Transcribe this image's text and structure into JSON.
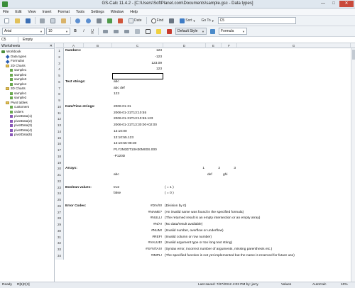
{
  "window": {
    "title": "GS-Calc 11.4.2 - [C:\\Users\\SoftPlanet.com\\Documents\\sample.gsc - Data types]",
    "controls": [
      "—",
      "□",
      "✕"
    ]
  },
  "menu": [
    "File",
    "Edit",
    "View",
    "Insert",
    "Format",
    "Tools",
    "Settings",
    "Window",
    "Help"
  ],
  "toolbar1": {
    "date_label": "Date",
    "find_label": "Find",
    "sort_label": "Sort",
    "goto_label": "Go To",
    "goto_value": "C5"
  },
  "toolbar2": {
    "font": "Arial",
    "size": "10",
    "style": "Default Style",
    "formula": "Formula"
  },
  "formula_bar": {
    "cell_ref": "C5",
    "value": "Empty"
  },
  "sidebar": {
    "title": "Worksheets",
    "items": [
      {
        "label": "Workbook",
        "icon": "book-icon",
        "indent": 0
      },
      {
        "label": "Data types",
        "icon": "diamond-icon",
        "indent": 1
      },
      {
        "label": "Formulas",
        "icon": "diamond-icon",
        "indent": 1
      },
      {
        "label": "2D Charts",
        "icon": "folder-icon",
        "indent": 1
      },
      {
        "label": "sample1",
        "icon": "sheet-icon",
        "indent": 2
      },
      {
        "label": "sample2",
        "icon": "sheet-icon",
        "indent": 2
      },
      {
        "label": "sample3",
        "icon": "sheet-icon",
        "indent": 2
      },
      {
        "label": "sample4",
        "icon": "sheet-icon",
        "indent": 2
      },
      {
        "label": "3D Charts",
        "icon": "folder-icon",
        "indent": 1
      },
      {
        "label": "sample1",
        "icon": "sheet-icon",
        "indent": 2
      },
      {
        "label": "sample2",
        "icon": "sheet-icon",
        "indent": 2
      },
      {
        "label": "Pivot tables",
        "icon": "folder-icon",
        "indent": 1
      },
      {
        "label": "customers",
        "icon": "sheet-icon",
        "indent": 2
      },
      {
        "label": "orders",
        "icon": "sheet-icon",
        "indent": 2
      },
      {
        "label": "pivotData(1)",
        "icon": "pivot-icon",
        "indent": 2
      },
      {
        "label": "pivotData(2)",
        "icon": "pivot-icon",
        "indent": 2
      },
      {
        "label": "pivotData(3)",
        "icon": "pivot-icon",
        "indent": 2
      },
      {
        "label": "pivotData(4)",
        "icon": "pivot-icon",
        "indent": 2
      },
      {
        "label": "pivotData(5)",
        "icon": "pivot-icon",
        "indent": 2
      }
    ]
  },
  "grid": {
    "columns": [
      "A",
      "B",
      "C",
      "D",
      "E",
      "F",
      "G"
    ],
    "rows": [
      "1",
      "2",
      "3",
      "4",
      "5",
      "6",
      "7",
      "8",
      "9",
      "10",
      "11",
      "12",
      "13",
      "14",
      "15",
      "16",
      "17",
      "18",
      "19",
      "20",
      "21",
      "22",
      "23",
      "24",
      "25",
      "26",
      "27",
      "28",
      "29",
      "30",
      "31",
      "32",
      "33",
      "34"
    ],
    "cells": {
      "A1": "Numbers:",
      "C1": "123",
      "C2": "-123",
      "C3": "123.09",
      "C4": "123",
      "A6": "Text strings:",
      "C6": "abc",
      "C7": "abc def",
      "C8": "123",
      "A10": "Date/Time strings:",
      "C10": "2006-01-31",
      "C11": "2006-01-31T13:10:55",
      "C12": "2006-01-31T13:10:55.123",
      "C13": "2006-01-31T13:30:00+02:00",
      "C14": "13:10:00",
      "C15": "13:10:55.123",
      "C16": "13:10:55-08:30",
      "C17": "P1Y2M3DT10H30M00S.000",
      "C18": "-P120D",
      "A20": "Arrays:",
      "D20": "1",
      "E20": "2",
      "F20": "3",
      "C21": "abc",
      "E21": "def",
      "F21": "ghi",
      "A23": "Boolean values:",
      "C23": "true",
      "D23": "( = 1 )",
      "C24": "false",
      "D24": "( = 0 )",
      "A26": "Error Codes:",
      "C26": "#DIV/0!",
      "D26": "(Division by 0)",
      "C27": "#NAME?",
      "D27": "(An invalid name was found in the specified formula)",
      "C28": "#NULL!",
      "D28": "(The returned result is an empty intersection or an empty array)",
      "C29": "#N/A!",
      "D29": "(No data/result available)",
      "C30": "#NUM!",
      "D30": "(Invalid number, overflow or underflow)",
      "C31": "#REF!",
      "D31": "(Invalid column or row number)",
      "C32": "#VALUE!",
      "D32": "(Invalid argument type or too long text string)",
      "C33": "#SYNTAX!",
      "D33": "(Syntax error, incorrect number of arguments, missing parenthesis etc.)",
      "C34": "#IMPL!",
      "D34": "(The specified function is not yet implemented but the name is reserved for future use)"
    }
  },
  "status": {
    "left": "Ready",
    "ref": "R[5]C[3]",
    "saved": "Last saved:  7/27/2012 4:03 PM  by: jerry",
    "values": "Values",
    "calc": "AutoCalc",
    "pct": "10%"
  },
  "colors": {
    "accent": "#2b5fb3",
    "close": "#c94a3c"
  }
}
